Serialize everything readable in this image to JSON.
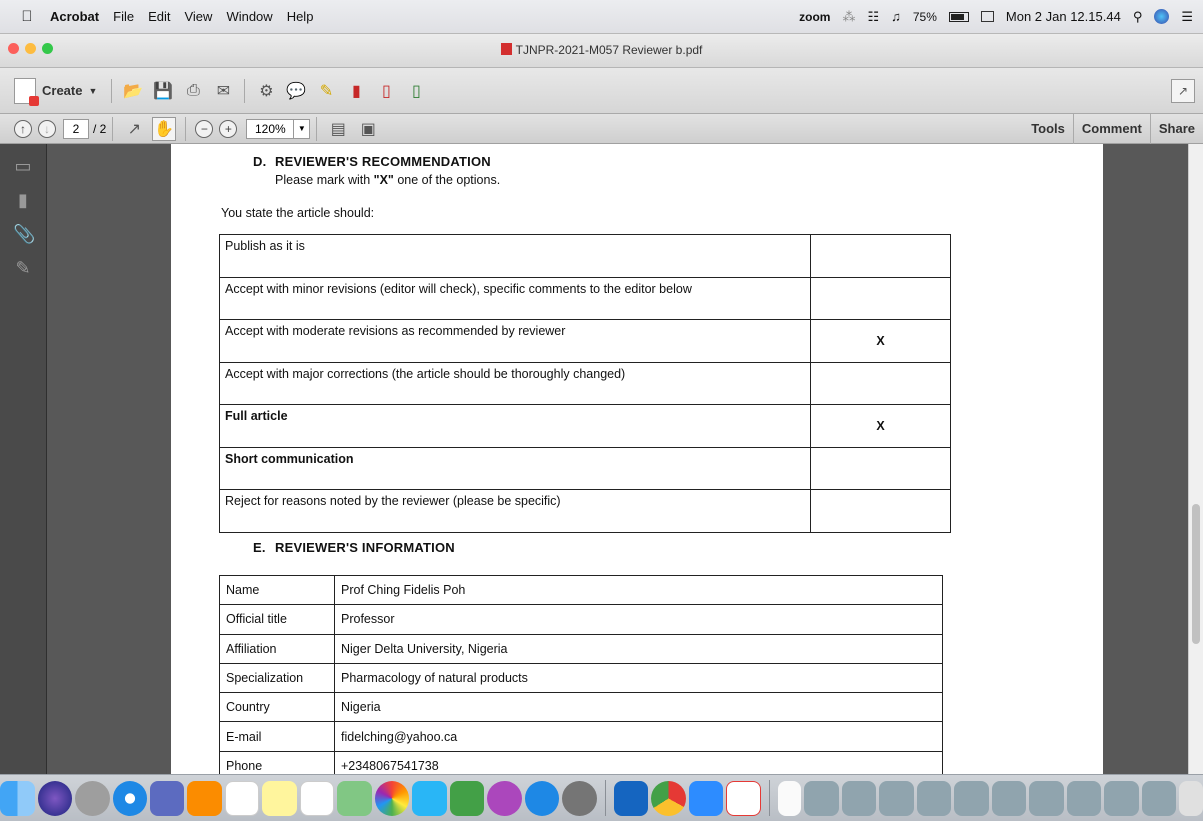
{
  "menubar": {
    "app": "Acrobat",
    "items": [
      "File",
      "Edit",
      "View",
      "Window",
      "Help"
    ],
    "zoom_label": "zoom",
    "battery": "75%",
    "clock": "Mon 2 Jan 12.15.44"
  },
  "window": {
    "title": "TJNPR-2021-M057 Reviewer b.pdf"
  },
  "toolbar": {
    "create_label": "Create",
    "page_current": "2",
    "page_total": "/ 2",
    "zoom": "120%",
    "tools_label": "Tools",
    "comment_label": "Comment",
    "share_label": "Share"
  },
  "document": {
    "section_d": {
      "letter": "D.",
      "title": "REVIEWER'S RECOMMENDATION",
      "instruction_pre": "Please mark with ",
      "instruction_mark": "\"X\"",
      "instruction_post": " one of the options.",
      "lead": "You state the article should:",
      "options": [
        {
          "label": "Publish as it is",
          "mark": "",
          "bold": false
        },
        {
          "label": "Accept with minor revisions (editor will check), specific comments to the editor below",
          "mark": "",
          "bold": false
        },
        {
          "label": "Accept with moderate revisions  as recommended by reviewer",
          "mark": "X",
          "bold": false
        },
        {
          "label": "Accept with major corrections (the article should be thoroughly changed)",
          "mark": "",
          "bold": false
        },
        {
          "label": "Full article",
          "mark": "X",
          "bold": true
        },
        {
          "label": "Short communication",
          "mark": "",
          "bold": true
        },
        {
          "label": "Reject for reasons noted by the reviewer (please be specific)",
          "mark": "",
          "bold": false
        }
      ]
    },
    "section_e": {
      "letter": "E.",
      "title": "REVIEWER'S INFORMATION",
      "rows": [
        {
          "label": "Name",
          "value": "Prof Ching Fidelis Poh"
        },
        {
          "label": "Official title",
          "value": "Professor"
        },
        {
          "label": "Affiliation",
          "value": "Niger Delta University, Nigeria"
        },
        {
          "label": "Specialization",
          "value": "Pharmacology of natural products"
        },
        {
          "label": "Country",
          "value": "Nigeria"
        },
        {
          "label": "E-mail",
          "value": "fidelching@yahoo.ca"
        },
        {
          "label": "Phone",
          "value": "+2348067541738"
        }
      ]
    }
  },
  "icons": {
    "create": "create-pdf-icon",
    "open": "open-folder-icon",
    "save": "save-icon",
    "print": "print-icon",
    "email": "email-icon",
    "settings": "gear-icon",
    "comment": "comment-bubble-icon",
    "highlight": "highlight-icon",
    "stamp": "stamp-icon"
  },
  "colors": {
    "light_red": "#fc605b",
    "light_yellow": "#fdbc40",
    "light_green": "#34c84a",
    "acrobat_red": "#d32f2f"
  }
}
